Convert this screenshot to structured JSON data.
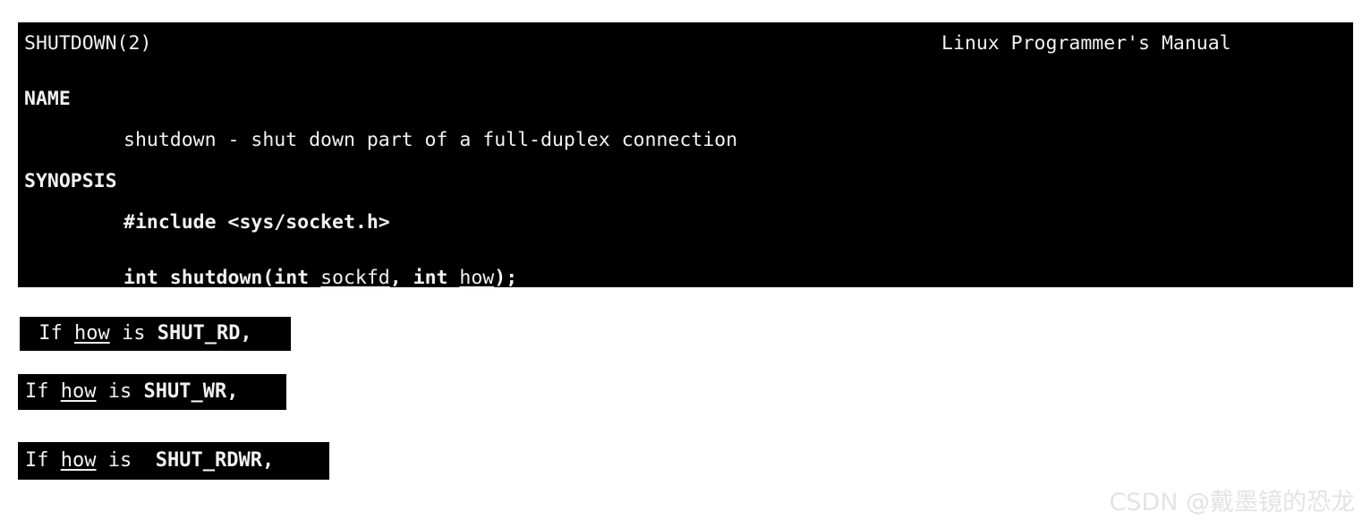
{
  "page": {
    "background_color": "#ffffff",
    "terminal_background": "#000000",
    "terminal_foreground": "#f2f2f2"
  },
  "man_page": {
    "header": {
      "left": "SHUTDOWN(2)",
      "right": "Linux Programmer's Manual"
    },
    "sections": {
      "name": {
        "heading": "NAME",
        "body": "shutdown - shut down part of a full-duplex connection"
      },
      "synopsis": {
        "heading": "SYNOPSIS",
        "include": "#include <sys/socket.h>",
        "prototype": {
          "prefix": "int shutdown(int ",
          "arg1": "sockfd",
          "separator": ", int ",
          "arg2": "how",
          "suffix": ");"
        }
      }
    }
  },
  "snippets": [
    {
      "id": "shut-rd",
      "prefix": " If ",
      "param": "how",
      "middle": " is ",
      "constant": "SHUT_RD,"
    },
    {
      "id": "shut-wr",
      "prefix": "If ",
      "param": "how",
      "middle": " is ",
      "constant": "SHUT_WR,"
    },
    {
      "id": "shut-rdwr",
      "prefix": "If ",
      "param": "how",
      "middle": " is  ",
      "constant": "SHUT_RDWR,"
    }
  ],
  "watermark": {
    "text": "CSDN @戴墨镜的恐龙",
    "color": "#e3e3e3"
  }
}
